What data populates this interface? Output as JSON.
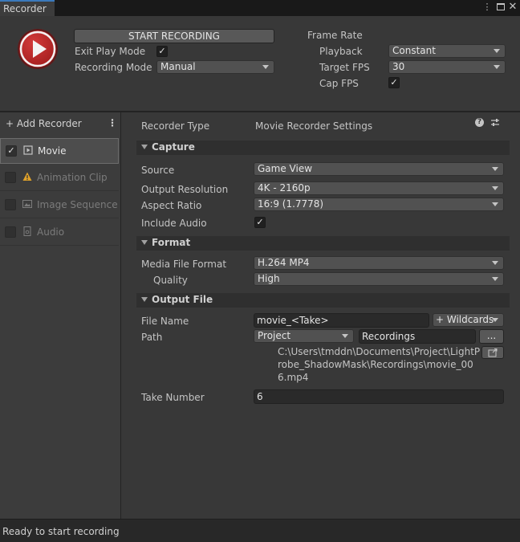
{
  "window": {
    "tab_title": "Recorder",
    "menu_icon": "kebab-menu-icon",
    "maximize_icon": "maximize-icon",
    "close_icon": "close-icon"
  },
  "top": {
    "start_recording_label": "START RECORDING",
    "exit_play_mode_label": "Exit Play Mode",
    "exit_play_mode_checked": true,
    "recording_mode_label": "Recording Mode",
    "recording_mode_value": "Manual",
    "frame_rate_label": "Frame Rate",
    "playback_label": "Playback",
    "playback_value": "Constant",
    "target_fps_label": "Target FPS",
    "target_fps_value": "30",
    "cap_fps_label": "Cap FPS",
    "cap_fps_checked": true,
    "checkmark": "✓"
  },
  "sidebar": {
    "add_recorder_label": "+ Add Recorder",
    "options_glyph": "⋮",
    "items": [
      {
        "label": "Movie",
        "enabled": true,
        "icon": "movie-icon"
      },
      {
        "label": "Animation Clip",
        "enabled": false,
        "icon": "warning-icon"
      },
      {
        "label": "Image Sequence",
        "enabled": false,
        "icon": "image-icon"
      },
      {
        "label": "Audio",
        "enabled": false,
        "icon": "audio-icon"
      }
    ]
  },
  "inspector": {
    "recorder_type_label": "Recorder Type",
    "recorder_type_value": "Movie Recorder Settings",
    "help_icon": "help-icon",
    "presets_icon": "presets-icon",
    "capture": {
      "title": "Capture",
      "source_label": "Source",
      "source_value": "Game View",
      "output_resolution_label": "Output Resolution",
      "output_resolution_value": "4K - 2160p",
      "aspect_ratio_label": "Aspect Ratio",
      "aspect_ratio_value": "16:9 (1.7778)",
      "include_audio_label": "Include Audio",
      "include_audio_checked": true
    },
    "format": {
      "title": "Format",
      "media_file_format_label": "Media File Format",
      "media_file_format_value": "H.264 MP4",
      "quality_label": "Quality",
      "quality_value": "High"
    },
    "output_file": {
      "title": "Output File",
      "file_name_label": "File Name",
      "file_name_value": "movie_<Take>",
      "wildcards_label": "+ Wildcards",
      "path_label": "Path",
      "path_root_value": "Project",
      "path_folder_value": "Recordings",
      "browse_label": "...",
      "full_path": "C:\\Users\\tmddn\\Documents\\Project\\LightProbe_ShadowMask\\Recordings\\movie_006.mp4",
      "reveal_icon": "open-folder-icon",
      "take_number_label": "Take Number",
      "take_number_value": "6"
    }
  },
  "status": {
    "text": "Ready to start recording"
  },
  "colors": {
    "background": "#383838",
    "record_red": "#c62a2a",
    "tab_accent": "#3a79bb"
  }
}
